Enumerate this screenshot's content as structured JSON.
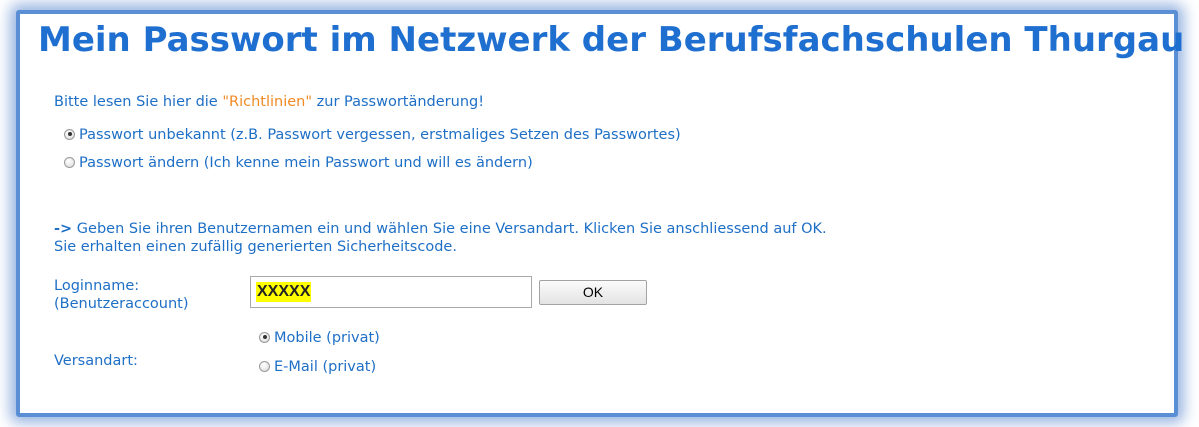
{
  "page": {
    "title": "Mein Passwort im Netzwerk der Berufsfachschulen Thurgau",
    "intro_prefix": "Bitte lesen Sie hier die ",
    "intro_link": "\"Richtlinien\"",
    "intro_suffix": " zur Passwortänderung!"
  },
  "mode_options": [
    {
      "label": "Passwort unbekannt (z.B. Passwort vergessen, erstmaliges Setzen des Passwortes)",
      "checked": true
    },
    {
      "label": "Passwort ändern (Ich kenne mein Passwort und will es ändern)",
      "checked": false
    }
  ],
  "instructions": {
    "arrow": "->",
    "line1": " Geben Sie ihren Benutzernamen ein und wählen Sie eine Versandart. Klicken Sie anschliessend auf OK.",
    "line2": "Sie erhalten einen zufällig generierten Sicherheitscode."
  },
  "login": {
    "label_line1": "Loginname:",
    "label_line2": "(Benutzeraccount)",
    "value": "XXXXX",
    "ok_label": "OK"
  },
  "versand": {
    "label": "Versandart:",
    "options": [
      {
        "label": "Mobile (privat)",
        "checked": true
      },
      {
        "label": "E-Mail (privat)",
        "checked": false
      }
    ]
  },
  "colors": {
    "text": "#1e6fc6",
    "title": "#1f6fd0",
    "link": "#f08a24",
    "highlight": "#ffff00",
    "frame": "#5a8fd6"
  }
}
